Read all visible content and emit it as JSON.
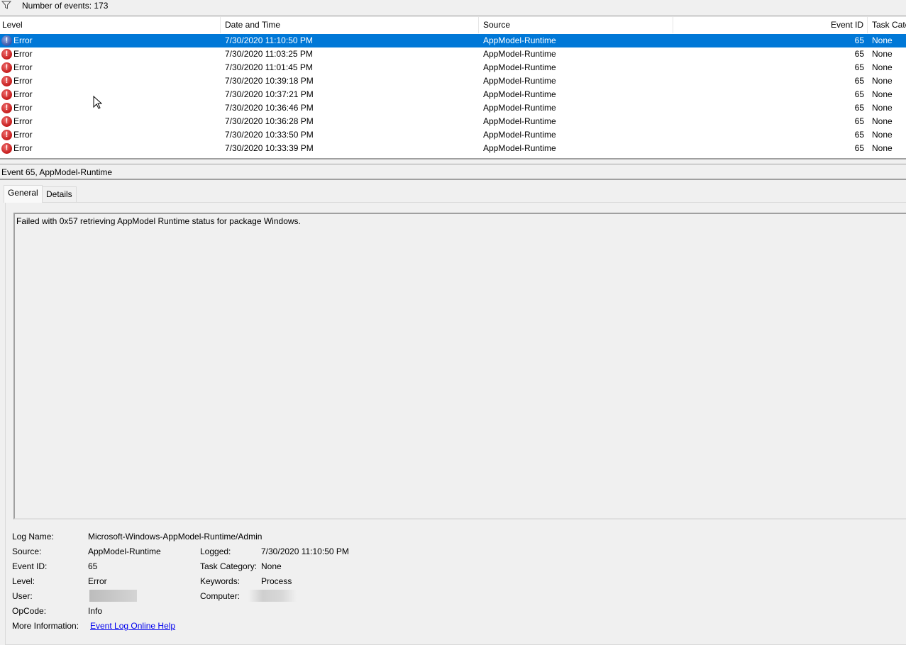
{
  "toolbar": {
    "filter_icon": "filter-icon",
    "event_count": "Number of events: 173"
  },
  "columns": [
    "Level",
    "Date and Time",
    "Source",
    "Event ID",
    "Task Cate"
  ],
  "rows": [
    {
      "level": "Error",
      "datetime": "7/30/2020 11:10:50 PM",
      "source": "AppModel-Runtime",
      "event_id": "65",
      "task": "None",
      "selected": true
    },
    {
      "level": "Error",
      "datetime": "7/30/2020 11:03:25 PM",
      "source": "AppModel-Runtime",
      "event_id": "65",
      "task": "None"
    },
    {
      "level": "Error",
      "datetime": "7/30/2020 11:01:45 PM",
      "source": "AppModel-Runtime",
      "event_id": "65",
      "task": "None"
    },
    {
      "level": "Error",
      "datetime": "7/30/2020 10:39:18 PM",
      "source": "AppModel-Runtime",
      "event_id": "65",
      "task": "None"
    },
    {
      "level": "Error",
      "datetime": "7/30/2020 10:37:21 PM",
      "source": "AppModel-Runtime",
      "event_id": "65",
      "task": "None"
    },
    {
      "level": "Error",
      "datetime": "7/30/2020 10:36:46 PM",
      "source": "AppModel-Runtime",
      "event_id": "65",
      "task": "None"
    },
    {
      "level": "Error",
      "datetime": "7/30/2020 10:36:28 PM",
      "source": "AppModel-Runtime",
      "event_id": "65",
      "task": "None"
    },
    {
      "level": "Error",
      "datetime": "7/30/2020 10:33:50 PM",
      "source": "AppModel-Runtime",
      "event_id": "65",
      "task": "None"
    },
    {
      "level": "Error",
      "datetime": "7/30/2020 10:33:39 PM",
      "source": "AppModel-Runtime",
      "event_id": "65",
      "task": "None"
    }
  ],
  "detail": {
    "title": "Event 65, AppModel-Runtime",
    "tabs": [
      "General",
      "Details"
    ],
    "message": "Failed with 0x57 retrieving AppModel Runtime status for package Windows.",
    "labels": {
      "log_name": "Log Name:",
      "source": "Source:",
      "event_id": "Event ID:",
      "level": "Level:",
      "user": "User:",
      "opcode": "OpCode:",
      "more_info": "More Information:",
      "logged": "Logged:",
      "task_category": "Task Category:",
      "keywords": "Keywords:",
      "computer": "Computer:"
    },
    "values": {
      "log_name": "Microsoft-Windows-AppModel-Runtime/Admin",
      "source": "AppModel-Runtime",
      "event_id": "65",
      "level": "Error",
      "opcode": "Info",
      "more_info": "Event Log Online Help",
      "logged": "7/30/2020 11:10:50 PM",
      "task_category": "None",
      "keywords": "Process"
    }
  },
  "colors": {
    "selection": "#0078d7",
    "error_icon": "#c41a1a",
    "link": "#0000ee"
  }
}
